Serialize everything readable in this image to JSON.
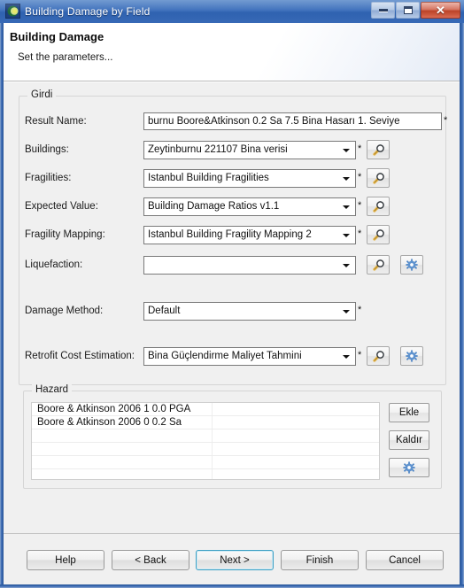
{
  "window": {
    "title": "Building Damage by Field",
    "icon": "app-crescent-icon",
    "controls": {
      "minimize": "minimize-icon",
      "maximize": "maximize-icon",
      "close": "✕"
    }
  },
  "header": {
    "title": "Building Damage",
    "subtitle": "Set the parameters..."
  },
  "input_group": {
    "legend": "Girdi",
    "required_mark": "*",
    "rows": [
      {
        "label": "Result Name:",
        "value": "burnu Boore&Atkinson 0.2 Sa 7.5 Bina Hasarı 1. Seviye",
        "type": "text",
        "required": true,
        "browse": false,
        "settings": false
      },
      {
        "label": "Buildings:",
        "value": "Zeytinburnu 221107 Bina verisi",
        "type": "combo",
        "required": true,
        "browse": true,
        "settings": false
      },
      {
        "label": "Fragilities:",
        "value": "Istanbul Building Fragilities",
        "type": "combo",
        "required": true,
        "browse": true,
        "settings": false
      },
      {
        "label": "Expected Value:",
        "value": "Building Damage Ratios v1.1",
        "type": "combo",
        "required": true,
        "browse": true,
        "settings": false
      },
      {
        "label": "Fragility Mapping:",
        "value": "Istanbul Building Fragility Mapping 2",
        "type": "combo",
        "required": true,
        "browse": true,
        "settings": false
      },
      {
        "label": "Liquefaction:",
        "value": "",
        "type": "combo",
        "required": false,
        "browse": true,
        "settings": true
      },
      {
        "label": "Damage Method:",
        "value": "Default",
        "type": "combo",
        "required": true,
        "browse": false,
        "settings": false
      },
      {
        "label": "Retrofit Cost Estimation:",
        "value": "Bina Güçlendirme Maliyet Tahmini",
        "type": "combo",
        "required": true,
        "browse": true,
        "settings": true
      }
    ]
  },
  "hazard_group": {
    "legend": "Hazard",
    "rows": [
      "Boore & Atkinson 2006 1 0.0 PGA",
      "Boore & Atkinson 2006 0 0.2 Sa",
      "",
      "",
      "",
      "",
      ""
    ],
    "add_label": "Ekle",
    "remove_label": "Kaldır",
    "settings_icon": "gear-icon"
  },
  "footer": {
    "buttons": [
      {
        "label": "Help",
        "default": false
      },
      {
        "label": "< Back",
        "default": false
      },
      {
        "label": "Next >",
        "default": true
      },
      {
        "label": "Finish",
        "default": false
      },
      {
        "label": "Cancel",
        "default": false
      }
    ]
  },
  "colors": {
    "titlebar": "#3d6fbb",
    "body": "#f0f0f0",
    "accent_focus": "#3da0c4",
    "close_button": "#bb4227",
    "gear_blue": "#3f7fc4",
    "magnifier_handle": "#e8b84b"
  }
}
